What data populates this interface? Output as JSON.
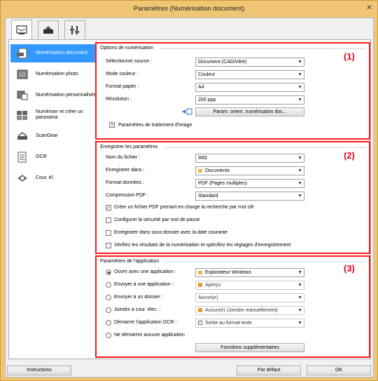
{
  "window": {
    "title": "Paramètres (Numérisation document)"
  },
  "tabs": [
    {
      "icon": "scan-from-computer-icon"
    },
    {
      "icon": "scan-from-panel-icon"
    },
    {
      "icon": "general-settings-icon"
    }
  ],
  "sidebar": {
    "items": [
      {
        "label": "Numérisation document",
        "icon": "document-scan-icon"
      },
      {
        "label": "Numérisation photo",
        "icon": "photo-scan-icon"
      },
      {
        "label": "Numérisation personnalisée",
        "icon": "custom-scan-icon"
      },
      {
        "label": "Numériser et créer un panorama",
        "icon": "panorama-icon"
      },
      {
        "label": "ScanGear",
        "icon": "scangear-icon"
      },
      {
        "label": "OCR",
        "icon": "ocr-icon"
      },
      {
        "label": "Cour. él.",
        "icon": "email-icon"
      }
    ]
  },
  "scan_options": {
    "title": "Options de numérisation",
    "marker": "(1)",
    "source_label": "Sélectionner source :",
    "source_value": "Document (CAD/Vitre)",
    "color_label": "Mode couleur :",
    "color_value": "Couleur",
    "paper_label": "Format papier :",
    "paper_value": "A4",
    "resolution_label": "Résolution :",
    "resolution_value": "200 ppp",
    "orient_button": "Param. orient. numérisation doc...",
    "image_processing": "Paramètres de traitement d'image",
    "expand_glyph": "+"
  },
  "save_settings": {
    "title": "Enregistrer les paramètres",
    "marker": "(2)",
    "filename_label": "Nom du fichier :",
    "filename_value": "IMG",
    "save_in_label": "Enregistrer dans :",
    "save_in_value": "Documents",
    "format_label": "Format données :",
    "format_value": "PDF (Pages multiples)",
    "compression_label": "Compression PDF :",
    "compression_value": "Standard",
    "check_searchable": "Créer un fichier PDF prenant en charge la recherche par mot clé",
    "check_password": "Configurer la sécurité par mot de passe",
    "check_subfolder": "Enregistrer dans sous-dossier avec la date courante",
    "check_verify": "Vérifiez les résultats de la numérisation et spécifiez les réglages d'enregistrement"
  },
  "app_settings": {
    "title": "Paramètres de l'application",
    "marker": "(3)",
    "open_label": "Ouvrir avec une application :",
    "open_value": "Explorateur Windows",
    "send_app_label": "Envoyer à une application :",
    "send_app_value": "Aperçu",
    "send_folder_label": "Envoyer à un dossier :",
    "send_folder_value": "Aucun(e)",
    "attach_label": "Joindre à cour. élec. :",
    "attach_value": "Aucun(e) (Joindre manuellement)",
    "ocr_label": "Démarrer l'application OCR :",
    "ocr_value": "Sortie au format texte",
    "none_label": "Ne démarrez aucune application",
    "more_button": "Fonctions supplémentaires"
  },
  "footer": {
    "instructions": "Instructions",
    "defaults": "Par défaut",
    "ok": "OK"
  },
  "colors": {
    "highlight": "#ff1a1a",
    "selection": "#3399ff",
    "titlebar": "#f0c674"
  }
}
